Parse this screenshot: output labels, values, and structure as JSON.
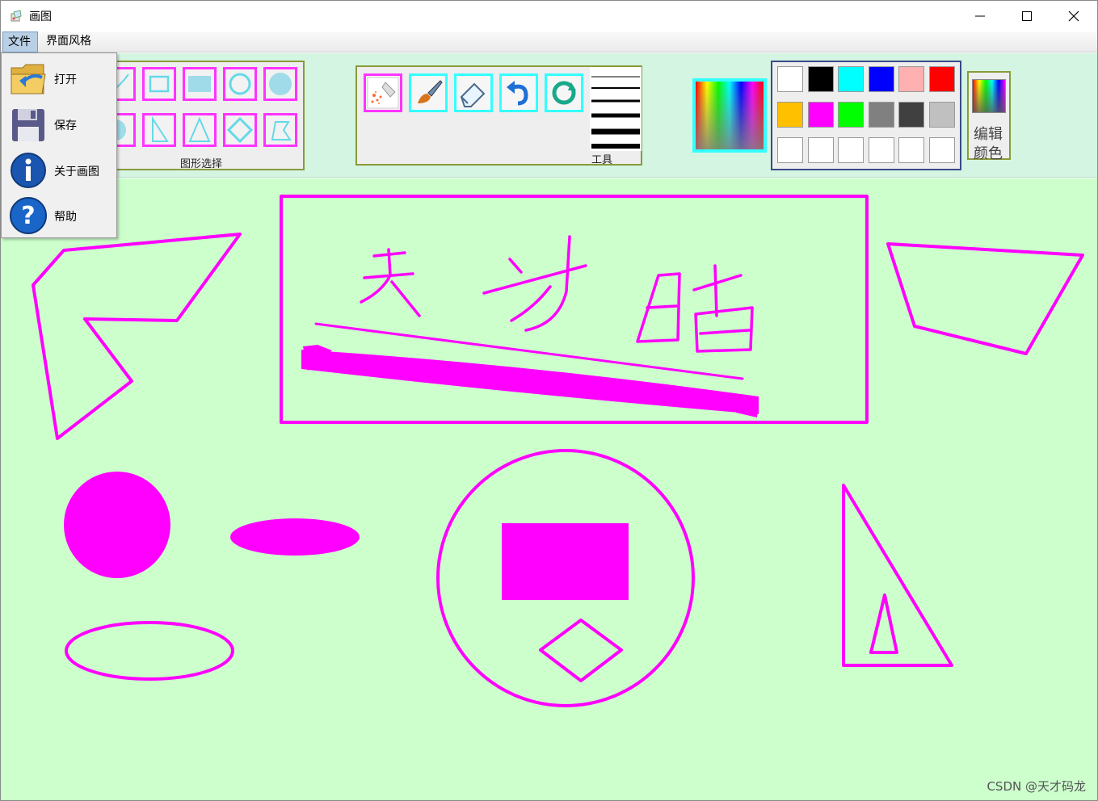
{
  "window": {
    "title": "画图"
  },
  "menubar": {
    "items": [
      {
        "label": "文件",
        "open": true
      },
      {
        "label": "界面风格"
      }
    ]
  },
  "file_menu": {
    "items": [
      {
        "label": "打开",
        "icon": "folder-open-icon"
      },
      {
        "label": "保存",
        "icon": "floppy-save-icon"
      },
      {
        "label": "关于画图",
        "icon": "info-icon"
      },
      {
        "label": "帮助",
        "icon": "help-icon"
      }
    ]
  },
  "shape_panel": {
    "label": "图形选择",
    "shapes": [
      "pencil-line",
      "rectangle",
      "filled-rectangle",
      "circle",
      "filled-circle",
      "filled-circle",
      "right-triangle",
      "triangle",
      "diamond",
      "polygon"
    ]
  },
  "tools_panel": {
    "label": "工具",
    "tools": [
      "spray-tool",
      "brush-tool",
      "eraser-tool",
      "undo-tool",
      "redo-tool"
    ]
  },
  "colors": {
    "current": "#ff00ff",
    "palette": [
      "#ffffff",
      "#000000",
      "#00ffff",
      "#0000ff",
      "#ffb0b0",
      "#ff0000",
      "#ffc000",
      "#ff00ff",
      "#00ff00",
      "#808080",
      "#404040",
      "#c0c0c0",
      "#ffffff",
      "#ffffff",
      "#ffffff",
      "#ffffff",
      "#ffffff",
      "#ffffff"
    ],
    "edit_label": "编辑颜色",
    "edit_label_line1": "编辑",
    "edit_label_line2": "颜色"
  },
  "canvas": {
    "background": "#ccffcc",
    "stroke_color": "#ff00ff",
    "handwriting": "天才皓"
  },
  "watermark": "CSDN @天才码龙"
}
